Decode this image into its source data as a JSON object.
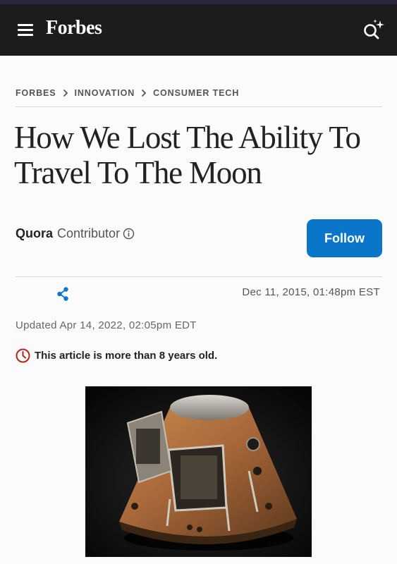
{
  "header": {
    "logo": "Forbes",
    "menu_icon": "hamburger-menu-icon",
    "search_icon": "search-sparkle-icon",
    "bg_color": "#1c1c1c"
  },
  "breadcrumb": [
    "FORBES",
    "INNOVATION",
    "CONSUMER TECH"
  ],
  "article": {
    "title": "How We Lost The Ability To Travel To The Moon",
    "author_name": "Quora",
    "author_role": "Contributor",
    "follow_label": "Follow",
    "published": "Dec 11, 2015, 01:48pm EST",
    "updated": "Updated Apr 14, 2022, 02:05pm EDT",
    "age_warning": "This article is more than 8 years old.",
    "hero_image": "apollo-command-module-photo"
  },
  "colors": {
    "accent": "#0b76c9",
    "warning": "#b3261e"
  }
}
